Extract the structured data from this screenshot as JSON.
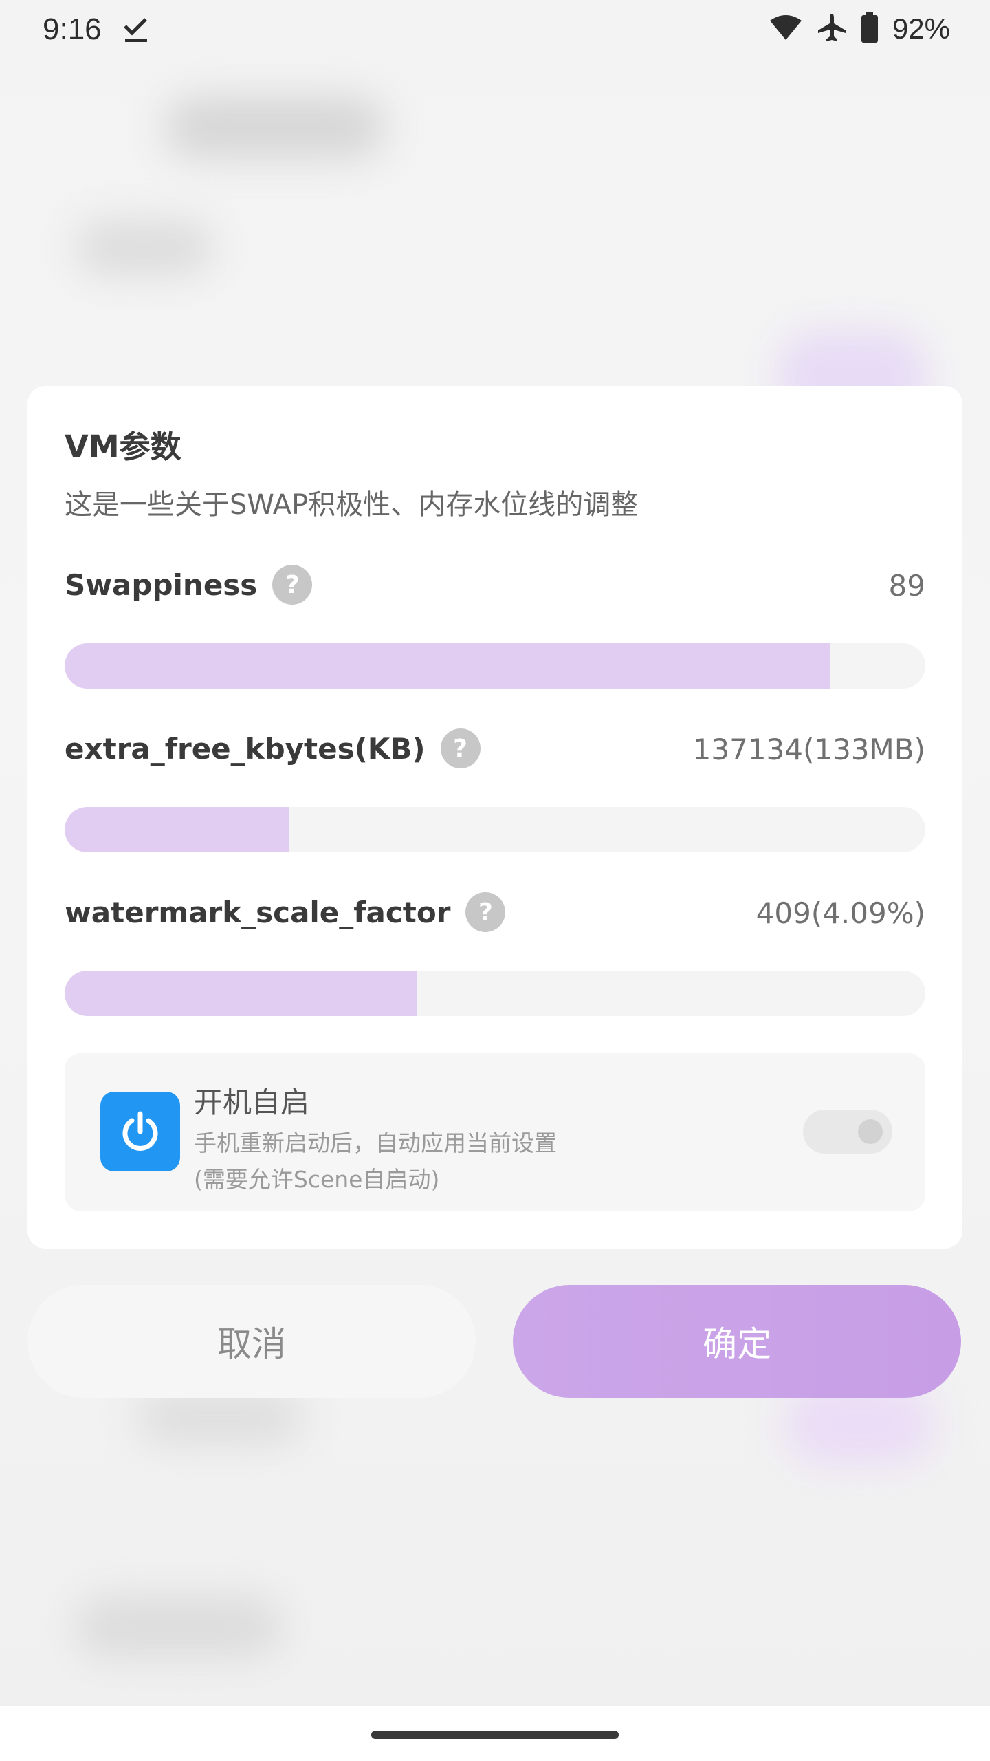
{
  "status_bar": {
    "time": "9:16",
    "battery": "92%",
    "icons": [
      "download-done-icon",
      "wifi-icon",
      "airplane-icon",
      "battery-icon"
    ]
  },
  "dialog": {
    "title": "VM参数",
    "description": "这是一些关于SWAP积极性、内存水位线的调整",
    "params": [
      {
        "label": "Swappiness",
        "value": "89",
        "level_fraction": 0.89
      },
      {
        "label": "extra_free_kbytes(KB)",
        "value": "137134(133MB)",
        "level_fraction": 0.26
      },
      {
        "label": "watermark_scale_factor",
        "value": "409(4.09%)",
        "level_fraction": 0.41
      }
    ],
    "help_glyph": "?",
    "autostart": {
      "title": "开机自启",
      "subtitle": "手机重新启动后，自动应用当前设置",
      "note": "(需要允许Scene自启动)",
      "enabled": false
    }
  },
  "buttons": {
    "cancel_label": "取消",
    "ok_label": "确定"
  },
  "colors": {
    "accent": "#c9a4e8",
    "bar_fill": "#e1cdf2",
    "power_icon_bg": "#2196f3"
  }
}
